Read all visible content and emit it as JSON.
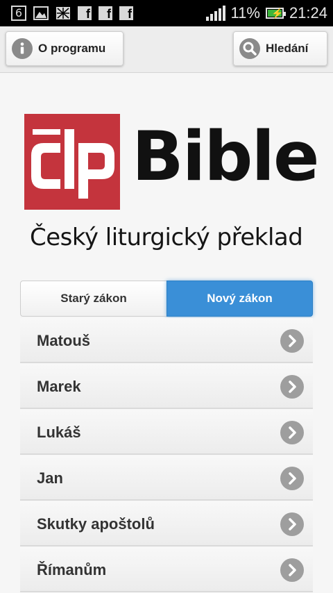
{
  "status_bar": {
    "notif_number": "6",
    "battery_percent": "11%",
    "time": "21:24",
    "icons": [
      "number-box-icon",
      "image-icon",
      "photo-icon",
      "facebook-icon",
      "facebook-icon",
      "facebook-icon",
      "signal-icon",
      "battery-charging-icon"
    ]
  },
  "topbar": {
    "about_label": "O programu",
    "search_label": "Hledání",
    "about_icon": "info-icon",
    "search_icon": "search-icon"
  },
  "logo": {
    "title": "Bible",
    "subtitle": "Český liturgický překlad",
    "brand_color": "#c4343d"
  },
  "segmented": {
    "old_label": "Starý zákon",
    "new_label": "Nový zákon",
    "selected": "new",
    "accent": "#3a8fd7"
  },
  "books": [
    {
      "label": "Matouš"
    },
    {
      "label": "Marek"
    },
    {
      "label": "Lukáš"
    },
    {
      "label": "Jan"
    },
    {
      "label": "Skutky apoštolů"
    },
    {
      "label": "Římanům"
    }
  ]
}
